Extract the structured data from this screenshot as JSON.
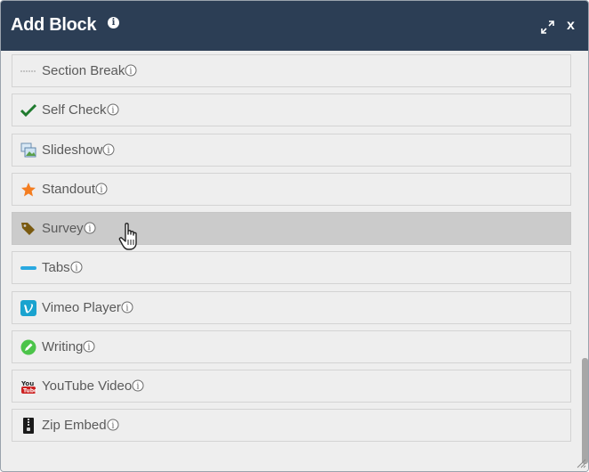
{
  "dialog": {
    "title": "Add Block",
    "close_label": "x",
    "info_glyph": "i"
  },
  "blocks": [
    {
      "label": "Section Break",
      "icon": "section-break-icon"
    },
    {
      "label": "Self Check",
      "icon": "checkmark-icon",
      "color": "#1f7a2e"
    },
    {
      "label": "Slideshow",
      "icon": "slideshow-icon"
    },
    {
      "label": "Standout",
      "icon": "star-icon",
      "color": "#f47d20"
    },
    {
      "label": "Survey",
      "icon": "tag-icon",
      "color": "#7a5a10",
      "state": "hovered"
    },
    {
      "label": "Tabs",
      "icon": "tabs-icon",
      "color": "#29a8e0"
    },
    {
      "label": "Vimeo Player",
      "icon": "vimeo-icon",
      "color": "#1aa3cf"
    },
    {
      "label": "Writing",
      "icon": "pencil-icon",
      "color": "#4cc44a"
    },
    {
      "label": "YouTube Video",
      "icon": "youtube-icon",
      "color": "#cc2222"
    },
    {
      "label": "Zip Embed",
      "icon": "zip-icon"
    }
  ],
  "colors": {
    "titlebar": "#2c3e55",
    "list_background": "#eeeeee",
    "hover_background": "#cbcbcb",
    "text": "#5a5a5a"
  }
}
